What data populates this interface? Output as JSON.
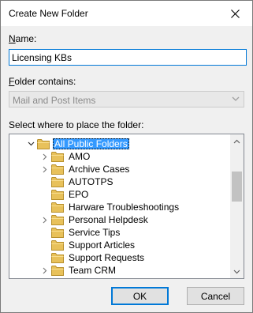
{
  "dialog": {
    "title": "Create New Folder",
    "close_icon": "close-icon"
  },
  "name": {
    "label_accel": "N",
    "label_rest": "ame:",
    "value": "Licensing KBs"
  },
  "contains": {
    "label_accel": "F",
    "label_rest": "older contains:",
    "value": "Mail and Post Items"
  },
  "place": {
    "label_pre": "Select where to place the folder:"
  },
  "tree": {
    "root": {
      "label": "All Public Folders",
      "expanded": true,
      "selected": true
    },
    "items": [
      {
        "label": "AMO",
        "expander": true
      },
      {
        "label": "Archive Cases",
        "expander": true
      },
      {
        "label": "AUTOTPS",
        "expander": false
      },
      {
        "label": "EPO",
        "expander": false
      },
      {
        "label": "Harware Troubleshootings",
        "expander": false
      },
      {
        "label": "Personal Helpdesk",
        "expander": true
      },
      {
        "label": "Service Tips",
        "expander": false
      },
      {
        "label": "Support Articles",
        "expander": false
      },
      {
        "label": "Support Requests",
        "expander": false
      },
      {
        "label": "Team CRM",
        "expander": true
      }
    ]
  },
  "buttons": {
    "ok": "OK",
    "cancel": "Cancel"
  },
  "colors": {
    "accent": "#0078d7",
    "selection": "#3399ff",
    "folder": "#e8c15a"
  }
}
